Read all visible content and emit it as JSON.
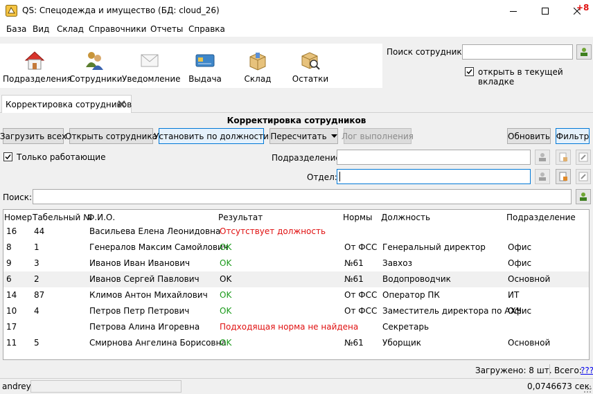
{
  "window": {
    "title": "QS: Спецодежда и имущество (БД: cloud_26)"
  },
  "menu": {
    "items": [
      "База",
      "Вид",
      "Склад",
      "Справочники",
      "Отчеты",
      "Справка"
    ],
    "badge": "+8"
  },
  "toolbar": {
    "items": [
      {
        "label": "Подразделения",
        "icon": "house-icon"
      },
      {
        "label": "Сотрудники",
        "icon": "people-icon"
      },
      {
        "label": "Уведомление",
        "icon": "envelope-icon"
      },
      {
        "label": "Выдача",
        "icon": "card-icon"
      },
      {
        "label": "Склад",
        "icon": "box-icon"
      },
      {
        "label": "Остатки",
        "icon": "box-search-icon"
      }
    ]
  },
  "employee_search": {
    "label": "Поиск сотрудника:",
    "value": "",
    "open_in_tab_label": "открыть в текущей вкладке",
    "open_in_tab_checked": true
  },
  "tab": {
    "label": "Корректировка сотрудников"
  },
  "panel": {
    "title": "Корректировка сотрудников",
    "buttons": {
      "load_all": "Загрузить всех",
      "open_employee": "Открыть сотрудника",
      "set_by_position": "Установить по должности",
      "recalculate": "Пересчитать",
      "log": "Лог выполнения",
      "refresh": "Обновить",
      "filter": "Фильтр"
    },
    "only_working_label": "Только работающие",
    "only_working_checked": true,
    "subdivision_label": "Подразделение:",
    "subdivision_value": "",
    "department_label": "Отдел:",
    "department_value": "",
    "search_label": "Поиск:",
    "search_value": ""
  },
  "table": {
    "columns": [
      "Номер",
      "Табельный №",
      "Ф.И.О.",
      "Результат",
      "Нормы",
      "Должность",
      "Подразделение"
    ],
    "rows": [
      {
        "num": "16",
        "tab": "44",
        "name": "Васильева Елена Леонидовна",
        "result": "Отсутствует должность",
        "status": "err",
        "norm": "",
        "position": "",
        "subdivision": ""
      },
      {
        "num": "8",
        "tab": "1",
        "name": "Генералов Максим Самойлович",
        "result": "OK",
        "status": "ok",
        "norm": "От ФСС",
        "position": "Генеральный директор",
        "subdivision": "Офис"
      },
      {
        "num": "9",
        "tab": "3",
        "name": "Иванов Иван Иванович",
        "result": "OK",
        "status": "ok",
        "norm": "№61",
        "position": "Завхоз",
        "subdivision": "Офис"
      },
      {
        "num": "6",
        "tab": "2",
        "name": "Иванов Сергей Павлович",
        "result": "OK",
        "status": "plain",
        "norm": "№61",
        "position": "Водопроводчик",
        "subdivision": "Основной"
      },
      {
        "num": "14",
        "tab": "87",
        "name": "Климов Антон Михайлович",
        "result": "OK",
        "status": "ok",
        "norm": "От ФСС",
        "position": "Оператор ПК",
        "subdivision": "ИТ"
      },
      {
        "num": "10",
        "tab": "4",
        "name": "Петров Петр Петрович",
        "result": "OK",
        "status": "ok",
        "norm": "От ФСС",
        "position": "Заместитель директора по АХЧ",
        "subdivision": "Офис"
      },
      {
        "num": "17",
        "tab": "",
        "name": "Петрова Алина Игоревна",
        "result": "Подходящая норма не найдена",
        "status": "err",
        "norm": "",
        "position": "Секретарь",
        "subdivision": ""
      },
      {
        "num": "11",
        "tab": "5",
        "name": "Смирнова Ангелина Борисовна",
        "result": "OK",
        "status": "ok",
        "norm": "№61",
        "position": "Уборщик",
        "subdivision": "Основной"
      }
    ]
  },
  "status": {
    "loaded": "Загружено: 8 шт.",
    "total_label": "Всего:",
    "total_link": "???",
    "user": "andrey",
    "time": "0,0746673 сек."
  },
  "colors": {
    "ok": "#1a9a1a",
    "error": "#e01010",
    "focus": "#0078d7"
  }
}
